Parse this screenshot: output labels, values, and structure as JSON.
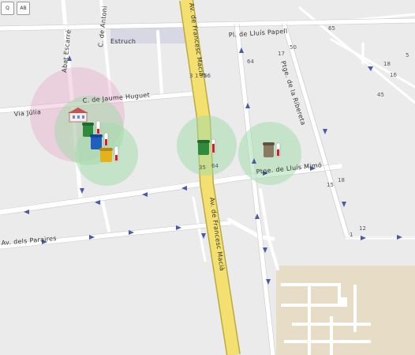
{
  "toolbar": {
    "locate_label": "Q",
    "abc_label": "AB"
  },
  "streets": {
    "abat_escarre": "Abat Escarré",
    "c_de_anton": "C. de Antoni",
    "estruch": "Estruch",
    "jaume_huguet": "C. de Jaume Huguet",
    "via_julia": "Via Júlia",
    "francesc_macia_top": "Av. de Francesc Macià",
    "francesc_macia_bottom": "Av. de Francesc Macià",
    "lluis_papell": "Pl. de Lluís Papell",
    "ribera": "Ptge. de la Ribereta",
    "lluis_mimo": "Ptge. de Lluís Mimó",
    "parares": "Av. dels Paraires"
  },
  "house_numbers": [
    "3",
    "1",
    "35",
    "66",
    "64",
    "17",
    "50",
    "65",
    "18",
    "5",
    "16",
    "45",
    "15",
    "18",
    "12",
    "1",
    "35",
    "64"
  ],
  "markers": [
    {
      "type": "municipal-building",
      "color": "#d9a0c0"
    },
    {
      "type": "container-green",
      "color": "#2e8b3e"
    },
    {
      "type": "container-blue",
      "color": "#1f5fbf"
    },
    {
      "type": "container-yellow",
      "color": "#e6b21c"
    },
    {
      "type": "container-green",
      "color": "#2e8b3e"
    },
    {
      "type": "container-brown",
      "color": "#7a6a55"
    }
  ],
  "colors": {
    "main_avenue": "#f3e070",
    "zone_pink": "#e99ac3",
    "zone_green": "#9fdca8",
    "block_tan": "#e6dcc6"
  }
}
